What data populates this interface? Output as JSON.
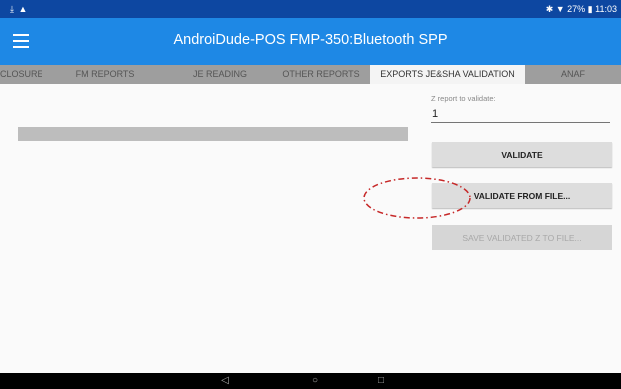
{
  "status_bar": {
    "left_icons": "⤓ ▲",
    "right_text": "✱ ▼ 27% ▮ 11:03"
  },
  "app_bar": {
    "title": "AndroiDude-POS   FMP-350:Bluetooth SPP"
  },
  "tabs": [
    {
      "label": "CLOSURE",
      "active": false
    },
    {
      "label": "FM REPORTS",
      "active": false
    },
    {
      "label": "JE READING",
      "active": false
    },
    {
      "label": "OTHER REPORTS",
      "active": false
    },
    {
      "label": "EXPORTS JE&SHA VALIDATION",
      "active": true
    },
    {
      "label": "ANAF",
      "active": false
    }
  ],
  "form": {
    "z_label": "Z report to validate:",
    "z_value": "1",
    "validate_label": "VALIDATE",
    "validate_from_file_label": "VALIDATE FROM FILE...",
    "save_validated_label": "SAVE VALIDATED Z TO FILE..."
  },
  "colors": {
    "status_bar": "#0d47a1",
    "app_bar": "#1e88e5",
    "annotation": "#c62828"
  },
  "icons": {
    "menu": "hamburger-icon",
    "back": "back-icon",
    "home": "home-icon",
    "recents": "recents-icon"
  },
  "nav": {
    "back_glyph": "◁",
    "home_glyph": "○",
    "recents_glyph": "□"
  }
}
